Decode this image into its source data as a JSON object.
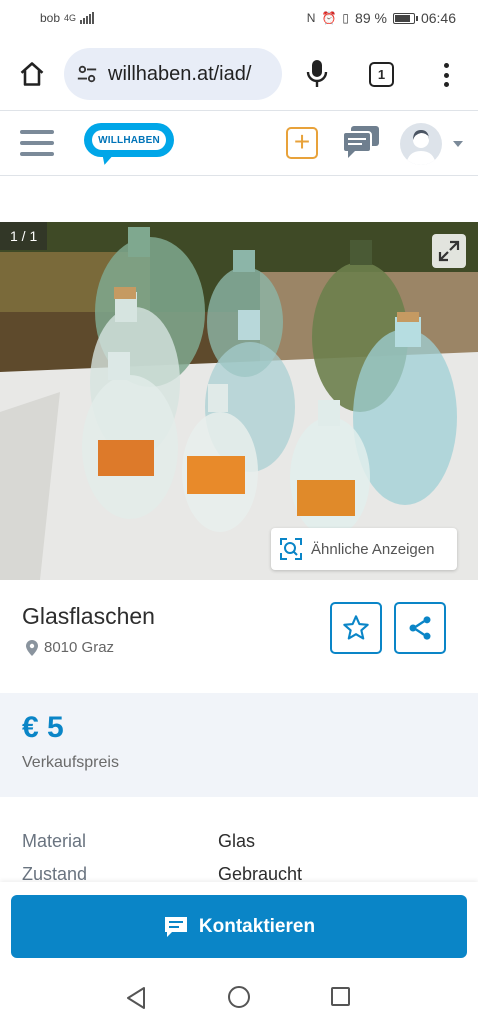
{
  "status_bar": {
    "carrier": "bob",
    "network": "4G",
    "battery_percent": "89 %",
    "time": "06:46"
  },
  "browser": {
    "url": "willhaben.at/iad/",
    "tab_count": "1",
    "icons": [
      "home-icon",
      "tune-icon",
      "mic-icon",
      "tabs-icon",
      "more-vert-icon"
    ]
  },
  "site_header": {
    "logo_text": "WILLHABEN",
    "brand_color": "#00a6e8",
    "add_color": "#e8a23a",
    "icons": [
      "menu-icon",
      "plus-icon",
      "chat-icon",
      "avatar-icon"
    ]
  },
  "gallery": {
    "counter": "1 / 1",
    "similar_label": "Ähnliche Anzeigen"
  },
  "listing": {
    "title": "Glasflaschen",
    "location": "8010 Graz"
  },
  "price": {
    "value": "€ 5",
    "label": "Verkaufspreis",
    "color": "#0a85c7"
  },
  "attributes": [
    {
      "key": "Material",
      "value": "Glas"
    },
    {
      "key": "Zustand",
      "value": "Gebraucht"
    }
  ],
  "contact": {
    "label": "Kontaktieren",
    "color": "#0a85c7"
  }
}
